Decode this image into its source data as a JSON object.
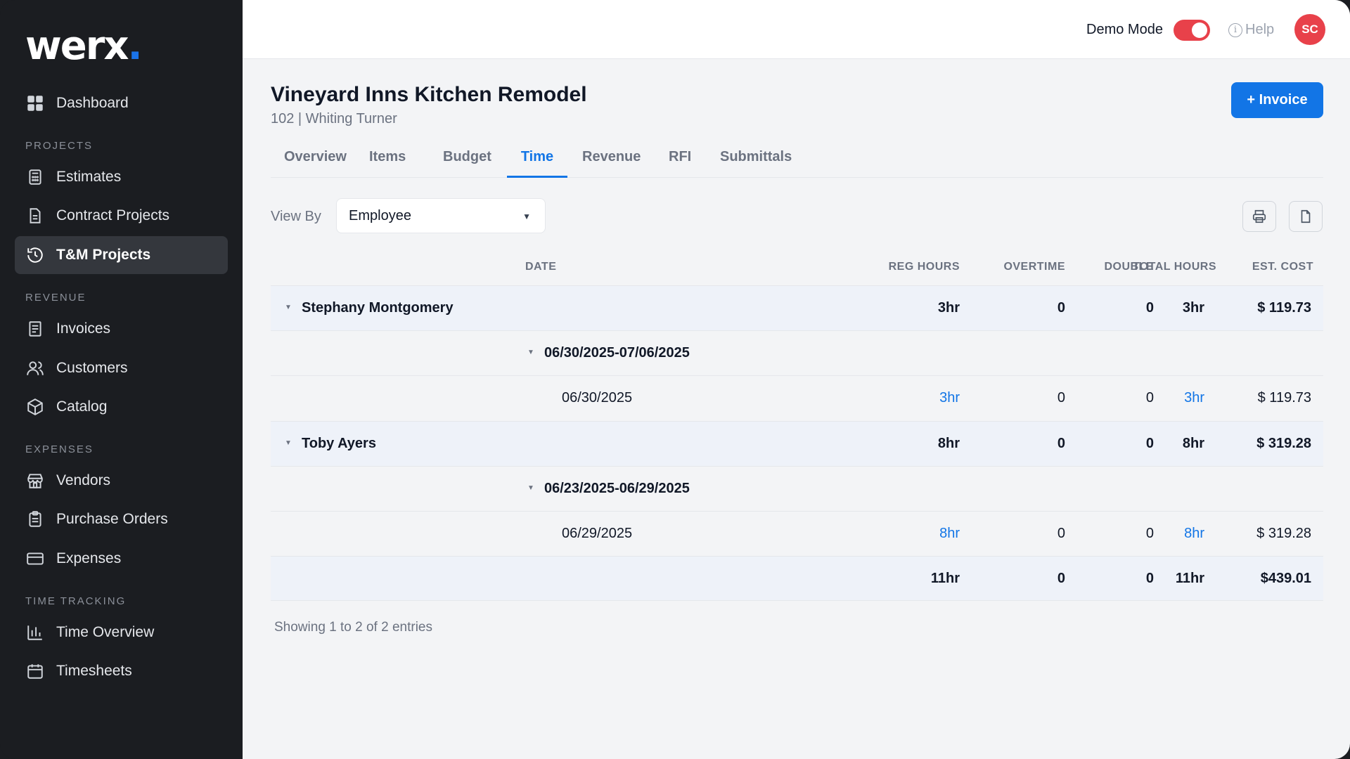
{
  "brand": {
    "logo": "werx",
    "logo_dot": "."
  },
  "sidebar": {
    "dashboard": "Dashboard",
    "sections": {
      "projects": "PROJECTS",
      "revenue": "REVENUE",
      "expenses": "EXPENSES",
      "time_tracking": "TIME TRACKING"
    },
    "items": {
      "estimates": "Estimates",
      "contract_projects": "Contract Projects",
      "tm_projects": "T&M Projects",
      "invoices": "Invoices",
      "customers": "Customers",
      "catalog": "Catalog",
      "vendors": "Vendors",
      "purchase_orders": "Purchase Orders",
      "expenses": "Expenses",
      "time_overview": "Time Overview",
      "timesheets": "Timesheets"
    },
    "active_item": "T&M Projects"
  },
  "topbar": {
    "demo_mode_label": "Demo Mode",
    "demo_mode_on": true,
    "help_label": "Help",
    "avatar_initials": "SC"
  },
  "project": {
    "title": "Vineyard Inns Kitchen Remodel",
    "subtitle": "102 | Whiting Turner",
    "invoice_button": "+ Invoice"
  },
  "tabs": [
    "Overview",
    "Items",
    "Budget",
    "Time",
    "Revenue",
    "RFI",
    "Submittals"
  ],
  "active_tab": "Time",
  "filters": {
    "view_by_label": "View By",
    "view_by_value": "Employee"
  },
  "table": {
    "headers": {
      "date": "DATE",
      "reg_hours": "REG HOURS",
      "overtime": "OVERTIME",
      "double": "DOUBLE",
      "total_hours": "TOTAL HOURS",
      "est_cost": "EST. COST"
    },
    "groups": [
      {
        "employee": "Stephany Montgomery",
        "reg": "3hr",
        "ot": "0",
        "dbl": "0",
        "total": "3hr",
        "cost": "$ 119.73",
        "period": "06/30/2025-07/06/2025",
        "entry": {
          "date": "06/30/2025",
          "reg": "3hr",
          "ot": "0",
          "dbl": "0",
          "total": "3hr",
          "cost": "$ 119.73"
        }
      },
      {
        "employee": "Toby Ayers",
        "reg": "8hr",
        "ot": "0",
        "dbl": "0",
        "total": "8hr",
        "cost": "$ 319.28",
        "period": "06/23/2025-06/29/2025",
        "entry": {
          "date": "06/29/2025",
          "reg": "8hr",
          "ot": "0",
          "dbl": "0",
          "total": "8hr",
          "cost": "$ 319.28"
        }
      }
    ],
    "totals": {
      "reg": "11hr",
      "ot": "0",
      "dbl": "0",
      "total": "11hr",
      "cost": "$439.01"
    }
  },
  "footer": {
    "showing": "Showing 1 to 2 of 2 entries"
  },
  "colors": {
    "accent": "#1275e6",
    "demo_toggle": "#e8414a",
    "sidebar_bg": "#1b1d21"
  }
}
